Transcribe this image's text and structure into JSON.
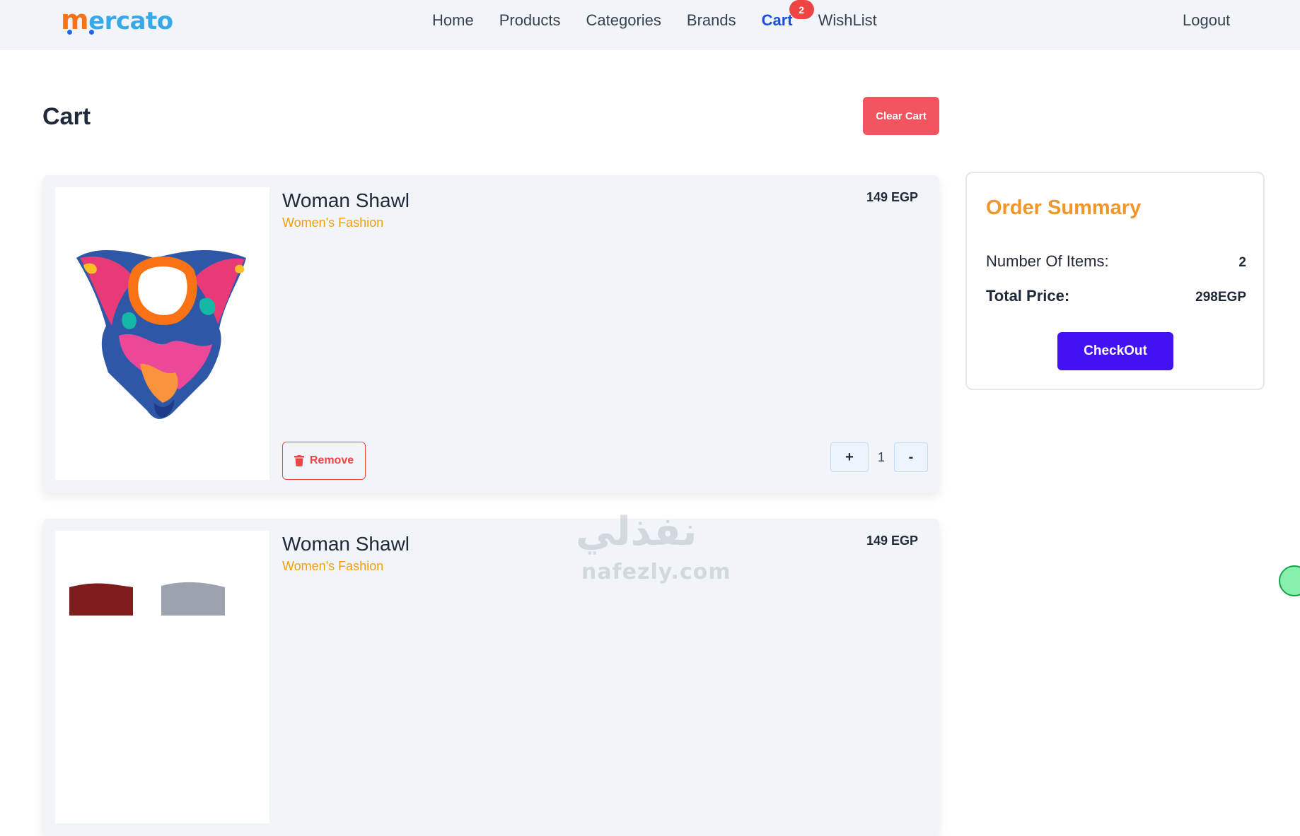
{
  "brand": {
    "logo_text_m": "m",
    "logo_text_rest": "ercato"
  },
  "nav": {
    "links": [
      {
        "label": "Home",
        "active": false
      },
      {
        "label": "Products",
        "active": false
      },
      {
        "label": "Categories",
        "active": false
      },
      {
        "label": "Brands",
        "active": false
      },
      {
        "label": "Cart",
        "active": true,
        "badge": "2"
      },
      {
        "label": "WishList",
        "active": false
      }
    ],
    "logout_label": "Logout"
  },
  "page": {
    "title": "Cart",
    "clear_label": "Clear Cart"
  },
  "cart": {
    "items": [
      {
        "title": "Woman Shawl",
        "category": "Women's Fashion",
        "price": "149 EGP",
        "remove_label": "Remove",
        "plus_label": "+",
        "quantity": "1",
        "minus_label": "-"
      },
      {
        "title": "Woman Shawl",
        "category": "Women's Fashion",
        "price": "149 EGP"
      }
    ]
  },
  "summary": {
    "title": "Order Summary",
    "items_label": "Number Of Items:",
    "items_value": "2",
    "total_label": "Total Price:",
    "total_value": "298EGP",
    "checkout_label": "CheckOut"
  },
  "watermark": {
    "arabic": "نفذلي",
    "latin": "nafezly.com"
  },
  "colors": {
    "accent_blue": "#1d4ed8",
    "clear_red": "#f2555f",
    "checkout_purple": "#4411f5",
    "summary_title_orange": "#f0962a",
    "category_orange": "#f59e0b"
  }
}
